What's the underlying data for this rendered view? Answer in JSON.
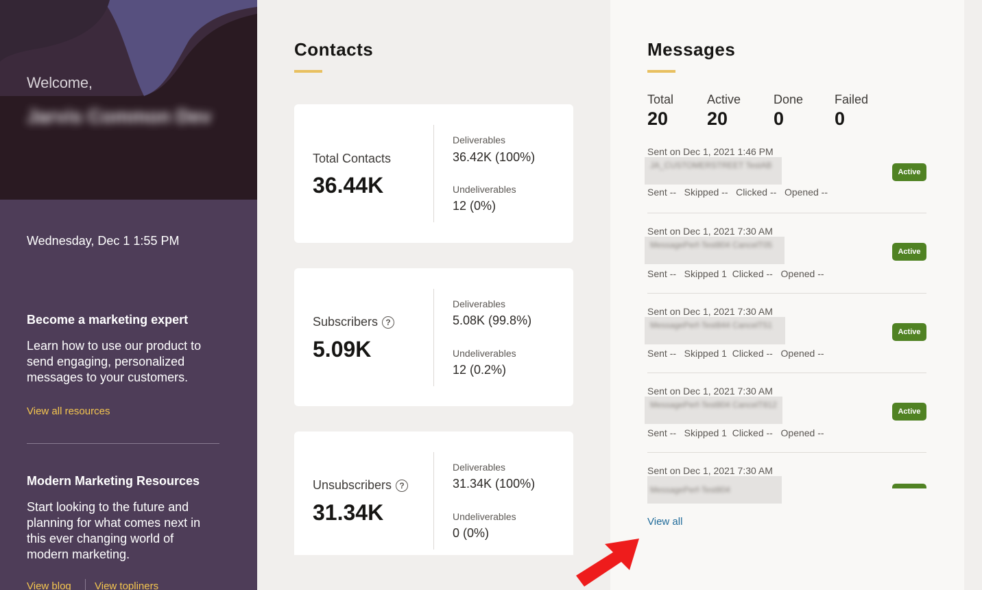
{
  "sidebar": {
    "welcome": "Welcome,",
    "user_name": "Jarvis Common Dev",
    "datetime": "Wednesday, Dec 1 1:55 PM",
    "expert": {
      "title": "Become a marketing expert",
      "text": "Learn how to use our product to send engaging, personalized messages to your customers.",
      "link": "View all resources"
    },
    "resources": {
      "title": "Modern Marketing Resources",
      "text": "Start looking to the future and planning for what comes next in this ever changing world of modern marketing.",
      "link_blog": "View blog",
      "link_topliners": "View topliners"
    }
  },
  "contacts": {
    "title": "Contacts",
    "cards": [
      {
        "label": "Total Contacts",
        "value": "36.44K",
        "deliverables_label": "Deliverables",
        "deliverables": "36.42K (100%)",
        "undeliverables_label": "Undeliverables",
        "undeliverables": "12 (0%)"
      },
      {
        "label": "Subscribers",
        "value": "5.09K",
        "deliverables_label": "Deliverables",
        "deliverables": "5.08K (99.8%)",
        "undeliverables_label": "Undeliverables",
        "undeliverables": "12 (0.2%)"
      },
      {
        "label": "Unsubscribers",
        "value": "31.34K",
        "deliverables_label": "Deliverables",
        "deliverables": "31.34K (100%)",
        "undeliverables_label": "Undeliverables",
        "undeliverables": "0 (0%)"
      }
    ]
  },
  "messages": {
    "title": "Messages",
    "stats": [
      {
        "label": "Total",
        "value": "20"
      },
      {
        "label": "Active",
        "value": "20"
      },
      {
        "label": "Done",
        "value": "0"
      },
      {
        "label": "Failed",
        "value": "0"
      }
    ],
    "items": [
      {
        "date": "Sent on Dec 1, 2021 1:46 PM",
        "name": "JA_CUSTOMERSTREET TestAB",
        "stats": "Sent --   Skipped --   Clicked --   Opened --",
        "status": "Active"
      },
      {
        "date": "Sent on Dec 1, 2021 7:30 AM",
        "name": "MessagePerf-Test804 CancelT05",
        "stats": "Sent --   Skipped 1  Clicked --   Opened --",
        "status": "Active"
      },
      {
        "date": "Sent on Dec 1, 2021 7:30 AM",
        "name": "MessagePerf-Test844 CancelT51",
        "stats": "Sent --   Skipped 1  Clicked --   Opened --",
        "status": "Active"
      },
      {
        "date": "Sent on Dec 1, 2021 7:30 AM",
        "name": "MessagePerf-Test804 CancelT812",
        "stats": "Sent --   Skipped 1  Clicked --   Opened --",
        "status": "Active"
      },
      {
        "date": "Sent on Dec 1, 2021 7:30 AM",
        "name": "MessagePerf-Test804",
        "stats": "",
        "status": "Active"
      }
    ],
    "view_all": "View all"
  },
  "colors": {
    "sidebar_bg": "#4e3d58",
    "accent_yellow": "#e8c060",
    "active_badge": "#508223",
    "link_blue": "#1f6b9a",
    "annotation_arrow": "#ee1c1c"
  }
}
